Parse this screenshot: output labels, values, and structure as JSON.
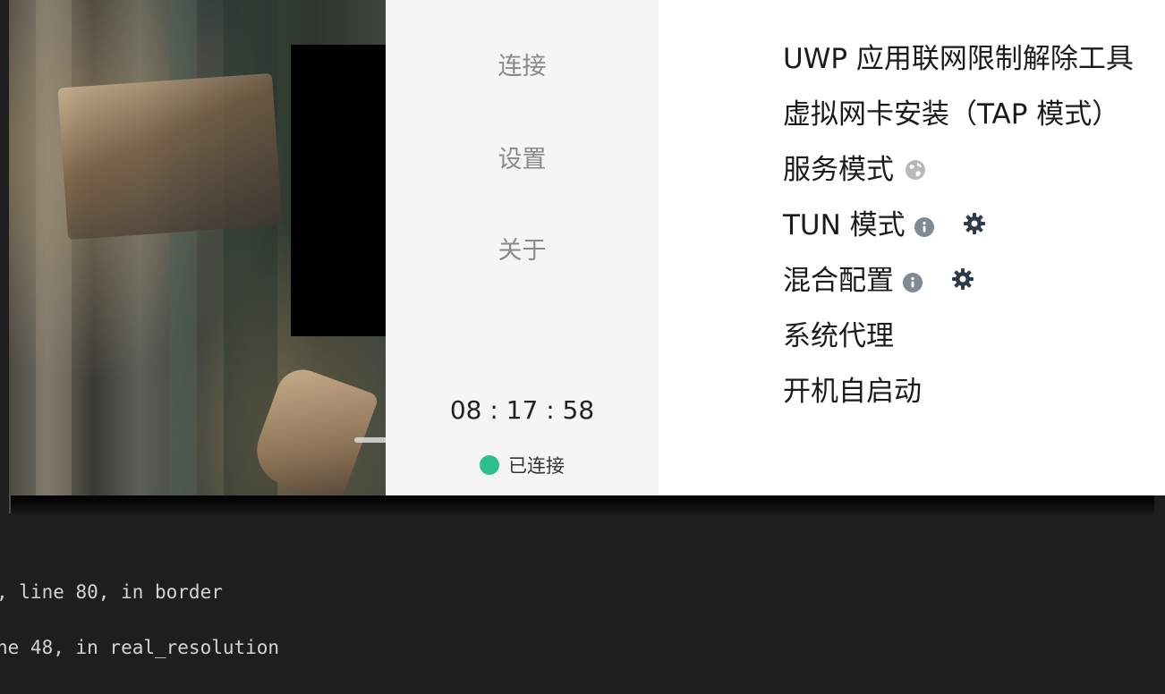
{
  "sidebar": {
    "nav": [
      {
        "label": "连接"
      },
      {
        "label": "设置"
      },
      {
        "label": "关于"
      }
    ],
    "timer": "08 : 17 : 58",
    "status": {
      "label": "已连接",
      "color": "#2fbf8f"
    }
  },
  "settings": {
    "items": [
      {
        "label": "UWP 应用联网限制解除工具"
      },
      {
        "label": "虚拟网卡安装（TAP 模式）"
      },
      {
        "label": "服务模式",
        "icon": "globe-icon"
      },
      {
        "label": "TUN 模式",
        "icons": [
          "info-icon",
          "gear-icon"
        ]
      },
      {
        "label": "混合配置",
        "icons": [
          "info-icon",
          "gear-icon"
        ]
      },
      {
        "label": "系统代理"
      },
      {
        "label": "开机自启动"
      }
    ]
  },
  "terminal": {
    "lines": [
      ", line 80, in border",
      "ne 48, in real_resolution"
    ]
  }
}
